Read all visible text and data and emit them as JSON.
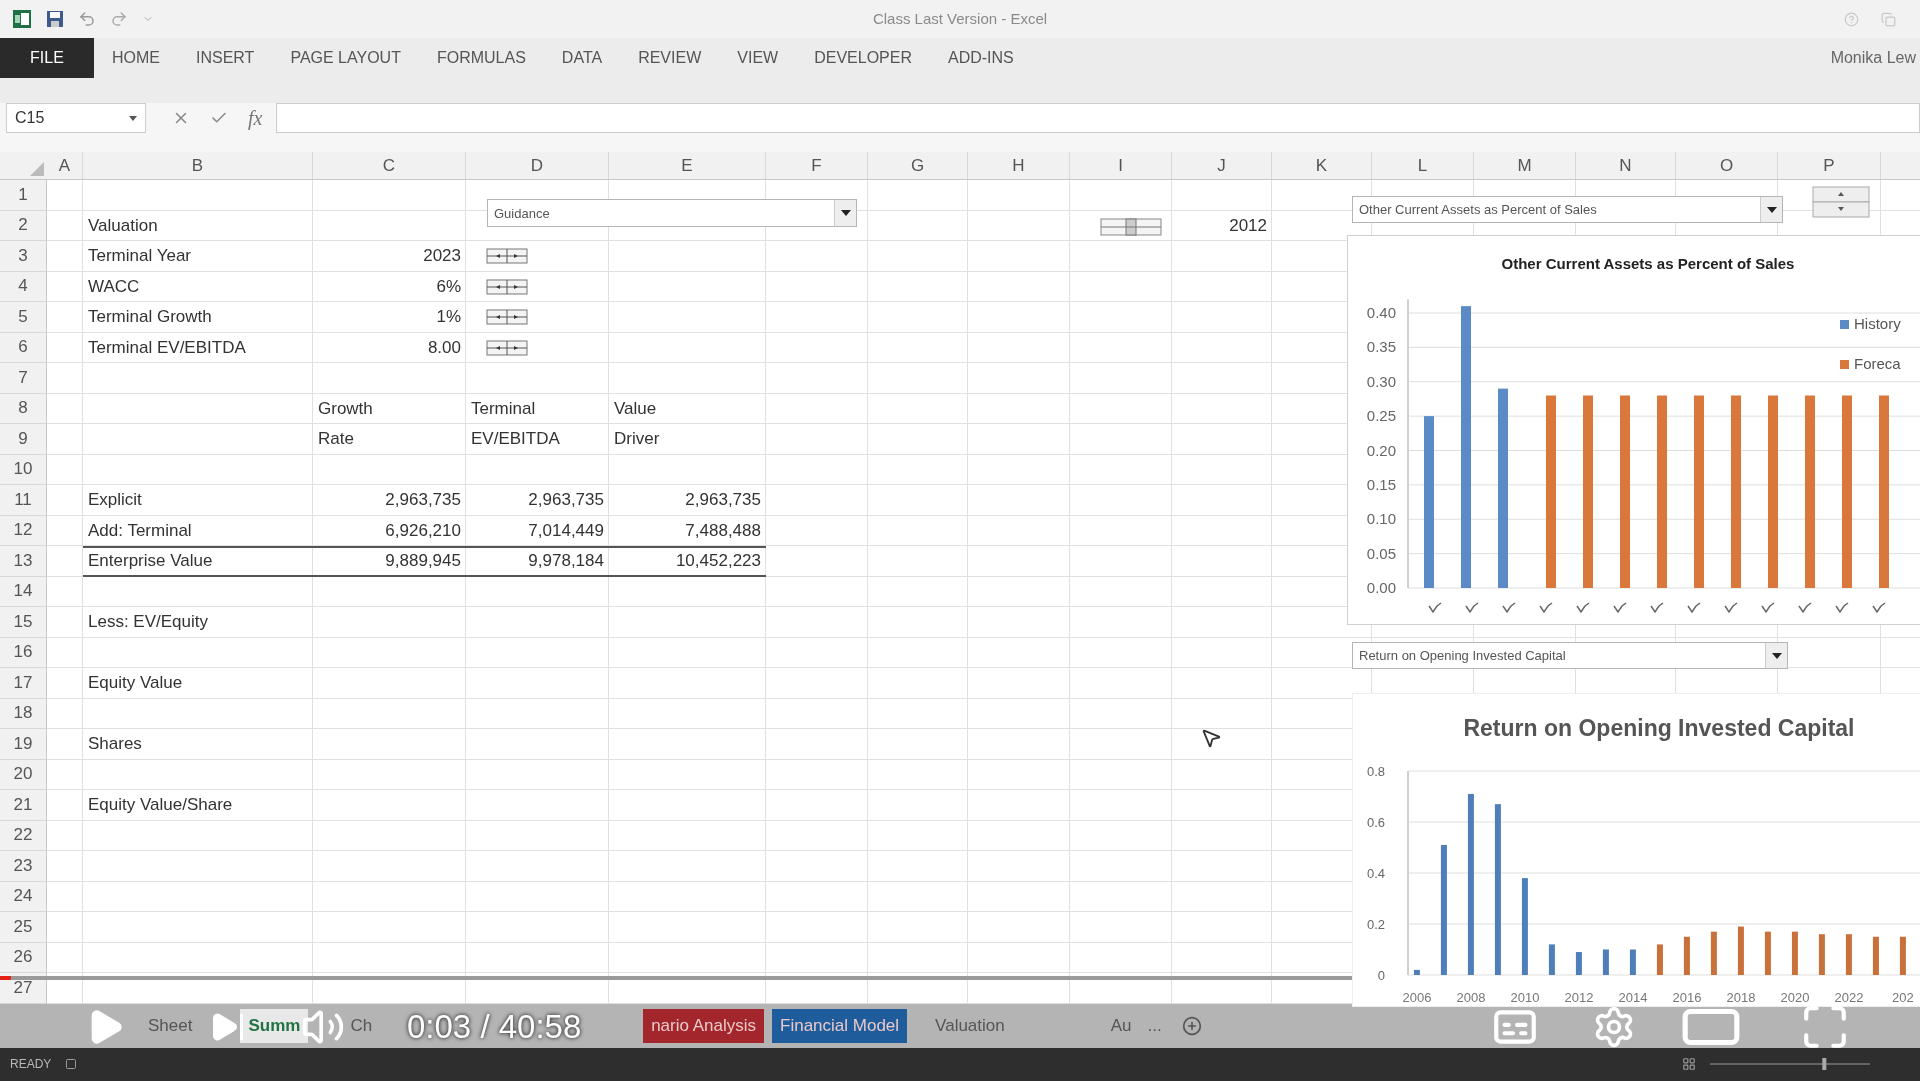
{
  "title_bar": {
    "title": "Class Last Version - Excel"
  },
  "ribbon": {
    "tabs": [
      {
        "label": "FILE",
        "selected": true
      },
      {
        "label": "HOME",
        "selected": false
      },
      {
        "label": "INSERT",
        "selected": false
      },
      {
        "label": "PAGE LAYOUT",
        "selected": false
      },
      {
        "label": "FORMULAS",
        "selected": false
      },
      {
        "label": "DATA",
        "selected": false
      },
      {
        "label": "REVIEW",
        "selected": false
      },
      {
        "label": "VIEW",
        "selected": false
      },
      {
        "label": "DEVELOPER",
        "selected": false
      },
      {
        "label": "ADD-INS",
        "selected": false
      }
    ],
    "user": "Monika Lew"
  },
  "formula_bar": {
    "name_box": "C15",
    "function_label": "fx"
  },
  "sheet": {
    "columns": [
      "A",
      "B",
      "C",
      "D",
      "E",
      "F",
      "G",
      "H",
      "I",
      "J",
      "K",
      "L",
      "M",
      "N",
      "O",
      "P"
    ],
    "rows": [
      {
        "number": "1"
      },
      {
        "number": "2",
        "cells": {
          "B": "Valuation",
          "J": "2012"
        }
      },
      {
        "number": "3",
        "cells": {
          "B": "Terminal Year",
          "C": "2023"
        },
        "spinner": true
      },
      {
        "number": "4",
        "cells": {
          "B": "WACC",
          "C": "6%"
        },
        "spinner": true
      },
      {
        "number": "5",
        "cells": {
          "B": "Terminal Growth",
          "C": "1%"
        },
        "spinner": true
      },
      {
        "number": "6",
        "cells": {
          "B": "Terminal EV/EBITDA",
          "C": "8.00"
        },
        "spinner": true
      },
      {
        "number": "7"
      },
      {
        "number": "8",
        "cells": {
          "C": "Growth",
          "D": "Terminal",
          "E": "Value"
        }
      },
      {
        "number": "9",
        "cells": {
          "C": "Rate",
          "D": "EV/EBITDA",
          "E": "Driver"
        }
      },
      {
        "number": "10"
      },
      {
        "number": "11",
        "cells": {
          "B": "Explicit",
          "C": "2,963,735",
          "D": "2,963,735",
          "E": "2,963,735"
        }
      },
      {
        "number": "12",
        "cells": {
          "B": "Add: Terminal",
          "C": "6,926,210",
          "D": "7,014,449",
          "E": "7,488,488"
        }
      },
      {
        "number": "13",
        "kind": "total",
        "cells": {
          "B": "Enterprise Value",
          "C": "9,889,945",
          "D": "9,978,184",
          "E": "10,452,223"
        }
      },
      {
        "number": "14"
      },
      {
        "number": "15",
        "cells": {
          "B": "Less: EV/Equity"
        }
      },
      {
        "number": "16"
      },
      {
        "number": "17",
        "cells": {
          "B": "Equity Value"
        }
      },
      {
        "number": "18"
      },
      {
        "number": "19",
        "cells": {
          "B": "Shares"
        }
      },
      {
        "number": "20"
      },
      {
        "number": "21",
        "cells": {
          "B": "Equity Value/Share"
        }
      },
      {
        "number": "22"
      },
      {
        "number": "23"
      },
      {
        "number": "24"
      },
      {
        "number": "25"
      },
      {
        "number": "26"
      },
      {
        "number": "27"
      }
    ]
  },
  "scenario_dropdown": {
    "value": "Guidance"
  },
  "chart_selector_top": {
    "value": "Other Current Assets as Percent of Sales"
  },
  "chart_top": {
    "chart_data": {
      "type": "bar",
      "title": "Other Current Assets as Percent of Sales",
      "grid": true,
      "legend": true,
      "ylim": [
        0,
        0.42
      ],
      "yticks": [
        {
          "value": 0,
          "label": "0.00"
        },
        {
          "value": 0.05,
          "label": "0.05"
        },
        {
          "value": 0.1,
          "label": "0.10"
        },
        {
          "value": 0.15,
          "label": "0.15"
        },
        {
          "value": 0.2,
          "label": "0.20"
        },
        {
          "value": 0.25,
          "label": "0.25"
        },
        {
          "value": 0.3,
          "label": "0.30"
        },
        {
          "value": 0.35,
          "label": "0.35"
        },
        {
          "value": 0.4,
          "label": "0.40"
        }
      ],
      "series": [
        {
          "name": "History",
          "color": "#5b8bc7",
          "values": [
            0.25,
            0.41,
            0.29,
            null,
            null,
            null,
            null,
            null,
            null,
            null,
            null,
            null,
            null
          ]
        },
        {
          "name": "Foreca",
          "color": "#d9783a",
          "values": [
            null,
            null,
            null,
            0.28,
            0.28,
            0.28,
            0.28,
            0.28,
            0.28,
            0.28,
            0.28,
            0.28,
            0.28
          ]
        }
      ]
    }
  },
  "chart_selector_bottom": {
    "value": "Return on Opening Invested Capital"
  },
  "chart_bottom": {
    "edge_tick_label": "202",
    "chart_data": {
      "type": "bar",
      "title": "Return on Opening Invested Capital",
      "grid": true,
      "xlim": [
        2005.67,
        2024.67
      ],
      "ylim": [
        0,
        0.8
      ],
      "x": [
        2006,
        2007,
        2008,
        2009,
        2010,
        2011,
        2012,
        2013,
        2014,
        2015,
        2016,
        2017,
        2018,
        2019,
        2020,
        2021,
        2022,
        2023,
        2024
      ],
      "xticks": [
        {
          "value": 2006,
          "label": "2006"
        },
        {
          "value": 2008,
          "label": "2008"
        },
        {
          "value": 2010,
          "label": "2010"
        },
        {
          "value": 2012,
          "label": "2012"
        },
        {
          "value": 2014,
          "label": "2014"
        },
        {
          "value": 2016,
          "label": "2016"
        },
        {
          "value": 2018,
          "label": "2018"
        },
        {
          "value": 2020,
          "label": "2020"
        },
        {
          "value": 2022,
          "label": "2022"
        }
      ],
      "yticks": [
        {
          "value": 0,
          "label": "0"
        },
        {
          "value": 0.2,
          "label": "0.2"
        },
        {
          "value": 0.4,
          "label": "0.4"
        },
        {
          "value": 0.6,
          "label": "0.6"
        },
        {
          "value": 0.8,
          "label": "0.8"
        }
      ],
      "series": [
        {
          "color": "#4f7fb8",
          "values": [
            0.02,
            0.51,
            0.71,
            0.67,
            0.38,
            0.12,
            0.09,
            0.1,
            0.1,
            null,
            null,
            null,
            null,
            null,
            null,
            null,
            null,
            null,
            null
          ]
        },
        {
          "color": "#c8713a",
          "values": [
            null,
            null,
            null,
            null,
            null,
            null,
            null,
            null,
            null,
            0.12,
            0.15,
            0.17,
            0.19,
            0.17,
            0.17,
            0.16,
            0.16,
            0.15,
            0.15
          ]
        }
      ]
    }
  },
  "sheet_tabs": [
    {
      "label": "Sheet",
      "selected": false
    },
    {
      "label": "Summ",
      "selected": true
    },
    {
      "label": "Ch",
      "selected": false
    },
    {
      "label": "nario Analysis",
      "selected": false,
      "color": "#a3262c"
    },
    {
      "label": "Financial Model",
      "selected": false,
      "color": "#1f5c9c"
    },
    {
      "label": "Valuation",
      "selected": false
    },
    {
      "label": "Au",
      "selected": false
    }
  ],
  "more_tabs": "...",
  "status_bar": {
    "text": "READY",
    "zoom": {
      "level": 0.72
    }
  },
  "player": {
    "time": "0:03 / 40:58",
    "progress": {
      "level": 0.008
    }
  }
}
